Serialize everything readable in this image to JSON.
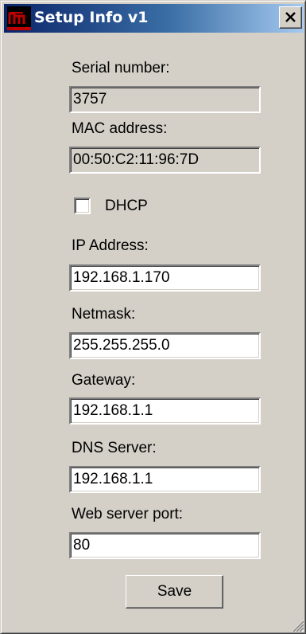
{
  "window": {
    "title": "Setup Info v1",
    "close_symbol": "X"
  },
  "icons": {
    "app": "app-logo-icon",
    "close": "close-icon",
    "grip": "resize-grip-icon"
  },
  "colors": {
    "title_start": "#0a246a",
    "title_end": "#a6caf0",
    "face": "#d4d0c8",
    "logo_red": "#c00000"
  },
  "form": {
    "serial_label": "Serial number:",
    "serial_value": "3757",
    "mac_label": "MAC address:",
    "mac_value": "00:50:C2:11:96:7D",
    "dhcp_label": "DHCP",
    "dhcp_checked": false,
    "ip_label": "IP Address:",
    "ip_value": "192.168.1.170",
    "netmask_label": "Netmask:",
    "netmask_value": "255.255.255.0",
    "gateway_label": "Gateway:",
    "gateway_value": "192.168.1.1",
    "dns_label": "DNS Server:",
    "dns_value": "192.168.1.1",
    "port_label": "Web server port:",
    "port_value": "80",
    "save_label": "Save"
  }
}
